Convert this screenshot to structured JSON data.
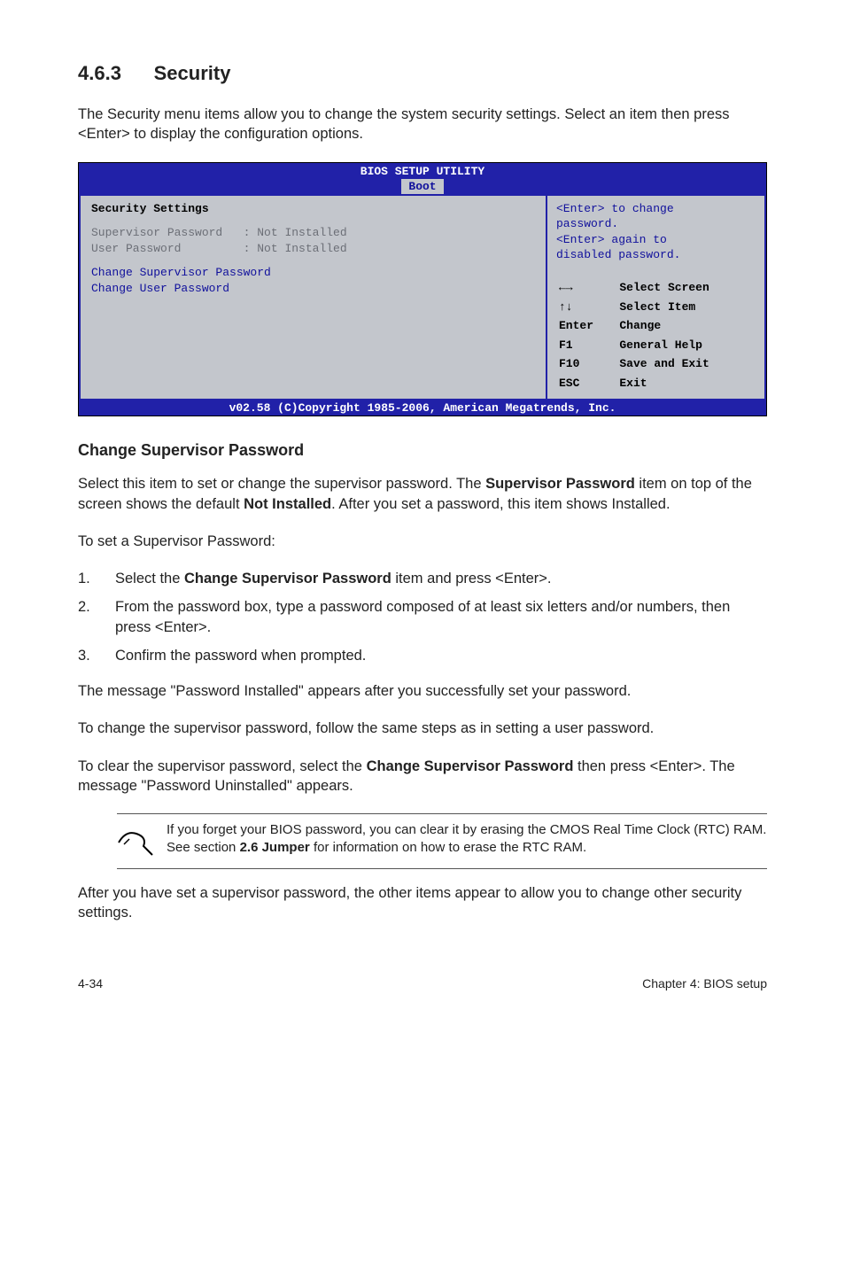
{
  "section": {
    "number": "4.6.3",
    "title": "Security"
  },
  "intro": "The Security menu items allow you to change the system security settings. Select an item then press <Enter> to display the configuration options.",
  "bios": {
    "header": "BIOS SETUP UTILITY",
    "tab": "Boot",
    "left": {
      "title": "Security Settings",
      "rows": [
        {
          "label": "Supervisor Password",
          "value": ": Not Installed"
        },
        {
          "label": "User Password",
          "value": ": Not Installed"
        }
      ],
      "actions": [
        "Change Supervisor Password",
        "Change User Password"
      ]
    },
    "right": {
      "help": [
        "<Enter> to change",
        "password.",
        "<Enter> again to",
        "disabled password."
      ],
      "keys": [
        {
          "k": "←→",
          "d": "Select Screen"
        },
        {
          "k": "↑↓",
          "d": "Select Item"
        },
        {
          "k": "Enter",
          "d": "Change"
        },
        {
          "k": "F1",
          "d": "General Help"
        },
        {
          "k": "F10",
          "d": "Save and Exit"
        },
        {
          "k": "ESC",
          "d": "Exit"
        }
      ]
    },
    "footer": "v02.58 (C)Copyright 1985-2006, American Megatrends, Inc."
  },
  "subhead": "Change Supervisor Password",
  "p1_a": "Select this item to set or change the supervisor password. The ",
  "p1_b": "Supervisor Password",
  "p1_c": " item on top of the screen shows the default ",
  "p1_d": "Not Installed",
  "p1_e": ". After you set a password, this item shows Installed.",
  "p2": "To set a Supervisor Password:",
  "steps": [
    {
      "n": "1.",
      "a": "Select the ",
      "b": "Change Supervisor Password",
      "c": " item and press <Enter>."
    },
    {
      "n": "2.",
      "a": "From the password box, type a password composed of at least six letters and/or numbers, then press <Enter>.",
      "b": "",
      "c": ""
    },
    {
      "n": "3.",
      "a": "Confirm the password when prompted.",
      "b": "",
      "c": ""
    }
  ],
  "p3": "The message \"Password Installed\" appears after you successfully set your password.",
  "p4": "To change the supervisor password, follow the same steps as in setting a user password.",
  "p5_a": "To clear the supervisor password, select the ",
  "p5_b": "Change Supervisor Password",
  "p5_c": " then press <Enter>. The message \"Password Uninstalled\" appears.",
  "note_a": "If you forget your BIOS password, you can clear it by erasing the CMOS Real Time Clock (RTC) RAM. See section ",
  "note_b": "2.6 Jumper",
  "note_c": " for information on how to erase the RTC RAM.",
  "p6": "After you have set a supervisor password, the other items appear to allow you to change other security settings.",
  "footer": {
    "left": "4-34",
    "right": "Chapter 4: BIOS setup"
  }
}
